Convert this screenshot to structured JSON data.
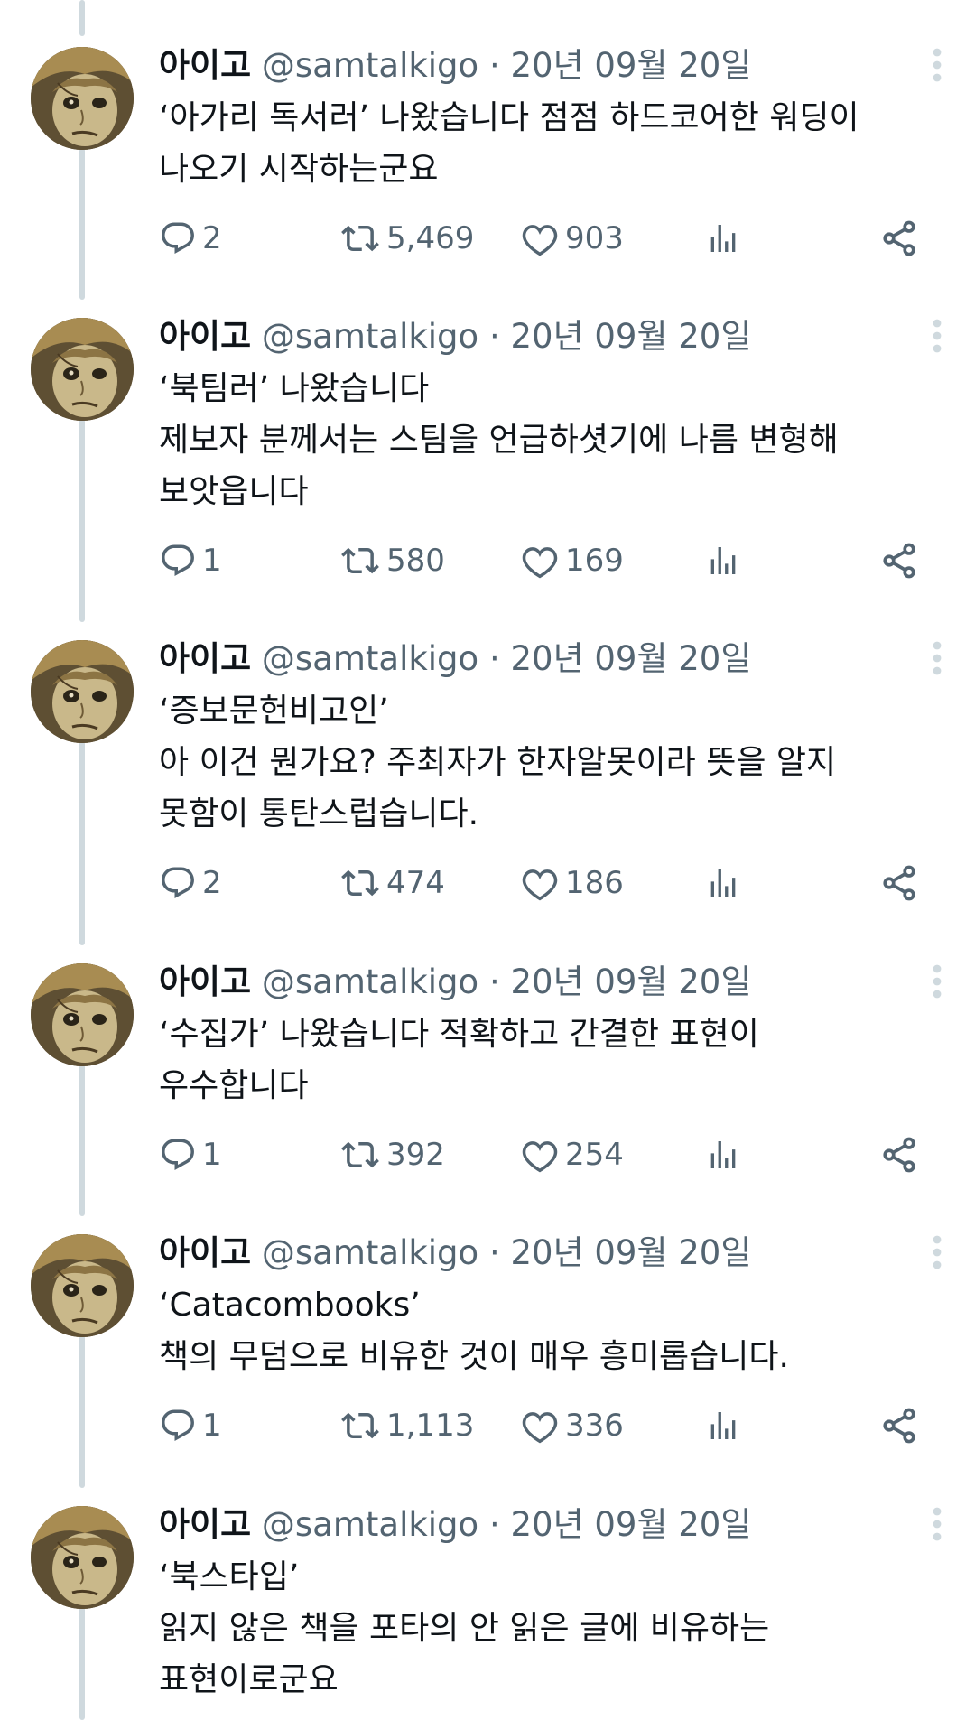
{
  "thread": {
    "tweets": [
      {
        "author": "아이고",
        "handle": "@samtalkigo",
        "separator": "·",
        "date": "20년 09월 20일",
        "text": "‘아가리 독서러’ 나왔습니다 점점 하드코어한 워딩이\n나오기 시작하는군요",
        "replies": "2",
        "retweets": "5,469",
        "likes": "903"
      },
      {
        "author": "아이고",
        "handle": "@samtalkigo",
        "separator": "·",
        "date": "20년 09월 20일",
        "text": "‘북팀러’ 나왔습니다\n제보자 분께서는 스팀을 언급하셧기에 나름 변형해\n보앗읍니다",
        "replies": "1",
        "retweets": "580",
        "likes": "169"
      },
      {
        "author": "아이고",
        "handle": "@samtalkigo",
        "separator": "·",
        "date": "20년 09월 20일",
        "text": "‘증보문헌비고인’\n아 이건 뭔가요? 주최자가 한자알못이라 뜻을 알지\n못함이 통탄스럽습니다.",
        "replies": "2",
        "retweets": "474",
        "likes": "186"
      },
      {
        "author": "아이고",
        "handle": "@samtalkigo",
        "separator": "·",
        "date": "20년 09월 20일",
        "text": "‘수집가’ 나왔습니다 적확하고 간결한 표현이\n우수합니다",
        "replies": "1",
        "retweets": "392",
        "likes": "254"
      },
      {
        "author": "아이고",
        "handle": "@samtalkigo",
        "separator": "·",
        "date": "20년 09월 20일",
        "text": "‘Catacombooks’\n책의 무덤으로 비유한 것이 매우 흥미롭습니다.",
        "replies": "1",
        "retweets": "1,113",
        "likes": "336"
      },
      {
        "author": "아이고",
        "handle": "@samtalkigo",
        "separator": "·",
        "date": "20년 09월 20일",
        "text": "‘북스타입’\n읽지 않은 책을 포타의 안 읽은 글에 비유하는\n표현이로군요",
        "replies": "",
        "retweets": "",
        "likes": ""
      }
    ]
  },
  "icons": {
    "reply": "reply-icon",
    "retweet": "retweet-icon",
    "like": "heart-icon",
    "views": "views-icon",
    "share": "share-icon",
    "more": "more-icon"
  },
  "colors": {
    "text": "#0f1419",
    "secondary": "#536471",
    "thread_line": "#cfd9de",
    "background": "#ffffff"
  }
}
